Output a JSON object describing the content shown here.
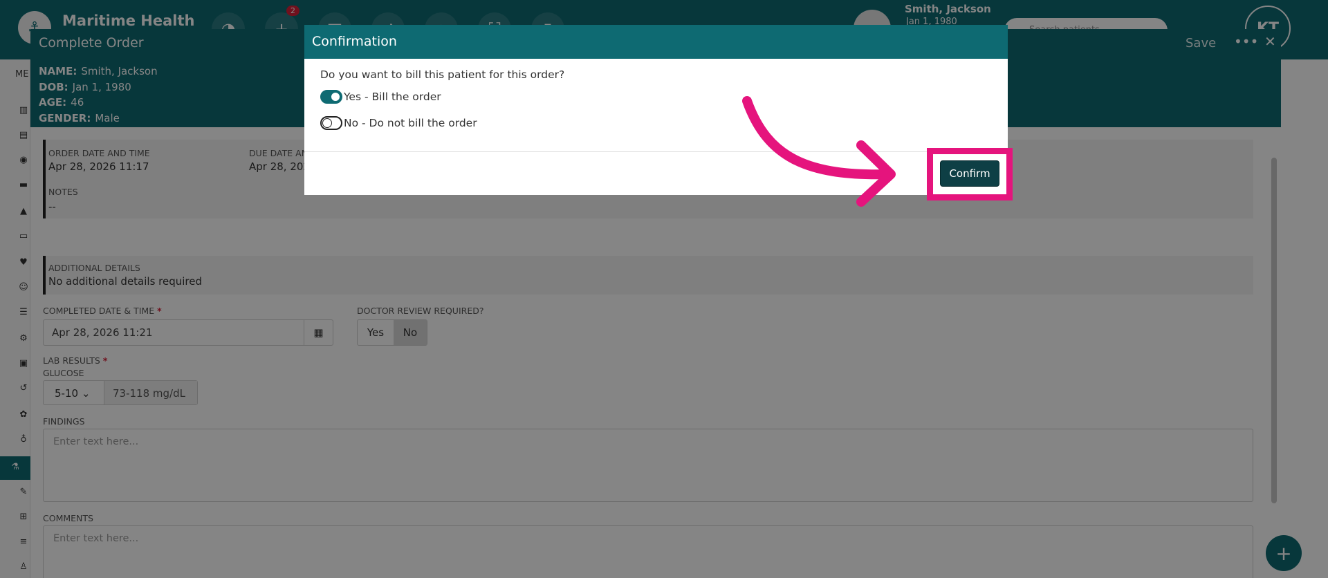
{
  "app": {
    "brand": "Maritime Health",
    "nav_badge": "2",
    "patient_name": "Smith, Jackson",
    "patient_dob": "Jan 1, 1980",
    "search_placeholder": "Search patients",
    "user_initials": "KT",
    "sidebar_label": "ME"
  },
  "panel": {
    "title": "Complete Order",
    "save_label": "Save",
    "more_icon": "more-icon",
    "close_icon": "close-icon",
    "patient": {
      "name_label": "NAME:",
      "name": "Smith, Jackson",
      "dob_label": "DOB:",
      "dob": "Jan 1, 1980",
      "age_label": "AGE:",
      "age": "46",
      "gender_label": "GENDER:",
      "gender": "Male"
    },
    "order_date_label": "ORDER DATE AND TIME",
    "order_date": "Apr 28, 2026 11:17",
    "due_date_label": "DUE DATE AN",
    "due_date": "Apr 28, 202",
    "notes_label": "NOTES",
    "notes": "--",
    "additional_label": "ADDITIONAL DETAILS",
    "additional": "No additional details required",
    "completed_label": "COMPLETED DATE & TIME",
    "completed_value": "Apr 28, 2026 11:21",
    "doctor_review_label": "DOCTOR REVIEW REQUIRED?",
    "doctor_review_yes": "Yes",
    "doctor_review_no": "No",
    "lab_results_label": "LAB RESULTS",
    "glucose_label": "GLUCOSE",
    "glucose_select": "5-10",
    "glucose_range": "73-118 mg/dL",
    "findings_label": "FINDINGS",
    "findings_placeholder": "Enter text here...",
    "comments_label": "COMMENTS",
    "comments_placeholder": "Enter text here..."
  },
  "modal": {
    "title": "Confirmation",
    "question": "Do you want to bill this patient for this order?",
    "option_yes": "Yes - Bill the order",
    "option_no": "No - Do not bill the order",
    "confirm_label": "Confirm"
  },
  "colors": {
    "teal": "#0e6a72",
    "dark_button": "#0e3f45",
    "highlight": "#e5147d",
    "required": "#d6223a"
  }
}
